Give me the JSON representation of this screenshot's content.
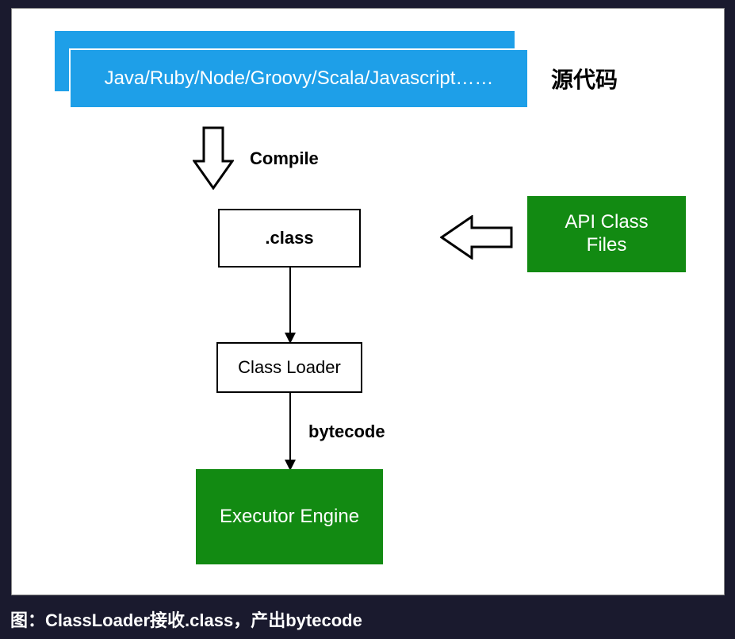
{
  "diagram": {
    "source_box": "Java/Ruby/Node/Groovy/Scala/Javascript……",
    "source_label": "源代码",
    "compile_label": "Compile",
    "class_box": ".class",
    "api_box": "API Class\nFiles",
    "loader_box": "Class Loader",
    "bytecode_label": "bytecode",
    "executor_box": "Executor Engine"
  },
  "caption": "图：ClassLoader接收.class，产出bytecode",
  "colors": {
    "blue": "#1e9fe8",
    "green": "#128a12",
    "bg": "#1a1a2e"
  }
}
